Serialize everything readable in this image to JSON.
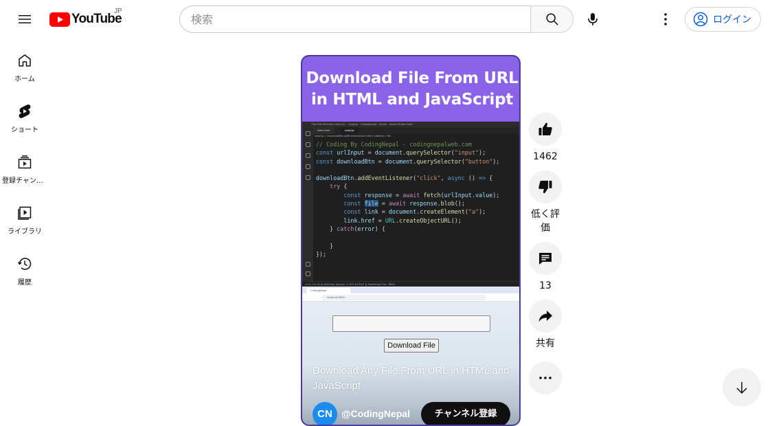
{
  "header": {
    "logo_text": "YouTube",
    "region": "JP",
    "search_placeholder": "検索",
    "login_label": "ログイン"
  },
  "sidebar": {
    "items": [
      {
        "label": "ホーム",
        "icon": "home-icon"
      },
      {
        "label": "ショート",
        "icon": "shorts-icon"
      },
      {
        "label": "登録チャンネル",
        "icon": "subscriptions-icon"
      },
      {
        "label": "ライブラリ",
        "icon": "library-icon"
      },
      {
        "label": "履歴",
        "icon": "history-icon"
      }
    ]
  },
  "short": {
    "banner_line1": "Download File From URL",
    "banner_line2": "in HTML and JavaScript",
    "vscode": {
      "titlebar": "File  Edit  Selection  View  Go  ...      script.js - CodingNepal - Shorts - Visual Studio Code",
      "tab1": "index.html",
      "tab2": "script.js",
      "breadcrumb": "script.js > downloadBtn.addEventListener('click') callback > file",
      "statusbar": "Ln 8, Col 19 (4 selected)   Spaces: 4   UTF-8   CRLF   {} JavaScript   Port : 5500"
    },
    "browser": {
      "tab": "CodingNepal",
      "url": "localhost:5500",
      "button_label": "Download File"
    },
    "caption": "Download Any File From URL in HTML and JavaScript",
    "channel_avatar": "CN",
    "channel_name": "@CodingNepal",
    "subscribe_label": "チャンネル登録"
  },
  "actions": {
    "like_count": "1462",
    "dislike_label": "低く評価",
    "comment_count": "13",
    "share_label": "共有"
  },
  "colors": {
    "brand_red": "#ff0000",
    "banner_purple": "#8a63e8",
    "link_blue": "#065fd4"
  }
}
